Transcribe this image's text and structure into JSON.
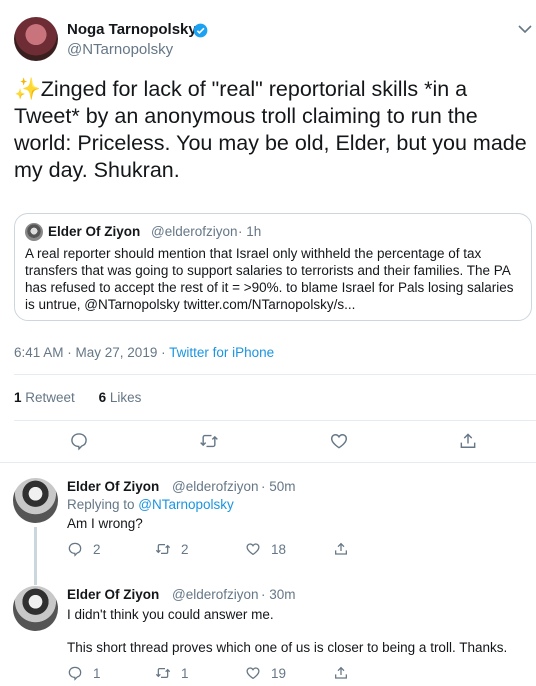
{
  "tweet": {
    "author_name": "Noga Tarnopolsky",
    "author_handle": "@NTarnopolsky",
    "text": "Zinged for lack of \"real\" reportorial skills *in a Tweet* by an anonymous troll claiming to run the world: Priceless. You may be old, Elder, but you made my day. Shukran.",
    "time_date": "6:41 AM · May 27, 2019 · ",
    "source": "Twitter for iPhone",
    "retweets_count": "1",
    "retweets_label": "Retweet",
    "likes_count": "6",
    "likes_label": "Likes"
  },
  "quote": {
    "name": "Elder Of Ziyon",
    "handle": "@elderofziyon",
    "time": "· 1h",
    "text": "A real reporter should mention that Israel only withheld the percentage of tax transfers that was going to support salaries to terrorists and their families. The PA has refused to accept the rest of it = >90%. to blame Israel for Pals losing salaries is untrue, @NTarnopolsky twitter.com/NTarnopolsky/s..."
  },
  "replies": [
    {
      "name": "Elder Of Ziyon",
      "handle": "@elderofziyon",
      "time": "· 50m",
      "replying_label": "Replying to ",
      "replying_to": "@NTarnopolsky",
      "text": "Am I wrong?",
      "replies": "2",
      "retweets": "2",
      "likes": "18"
    },
    {
      "name": "Elder Of Ziyon",
      "handle": "@elderofziyon",
      "time": "· 30m",
      "text": "I didn't think you could answer me.",
      "text2": "This short thread proves which one of us is closer to being a troll. Thanks.",
      "replies": "1",
      "retweets": "1",
      "likes": "19"
    }
  ],
  "colors": {
    "accent": "#1b95e0",
    "muted": "#657786",
    "border": "#e6ecf0",
    "text": "#14171a"
  }
}
